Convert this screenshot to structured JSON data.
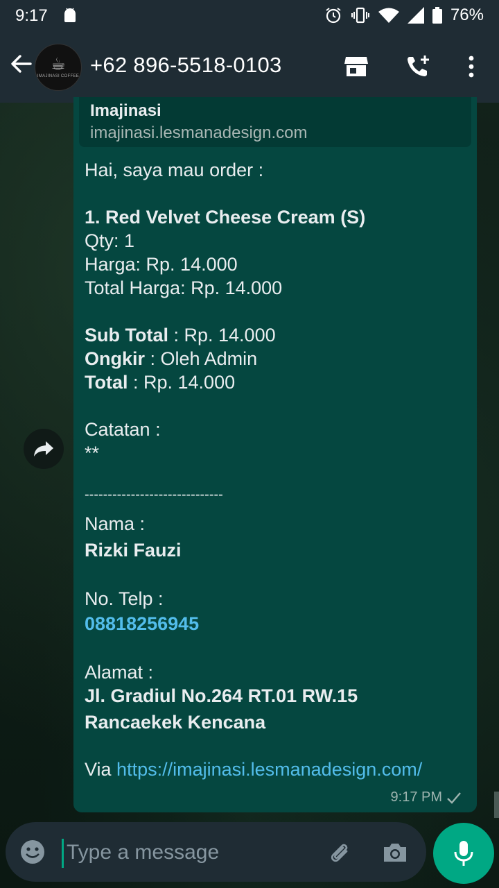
{
  "status_bar": {
    "time": "9:17",
    "battery": "76%"
  },
  "header": {
    "contact": "+62 896-5518-0103",
    "avatar_brand": "IMAJINASI COFFEE"
  },
  "link_preview": {
    "title": "Imajinasi",
    "url": "imajinasi.lesmanadesign.com"
  },
  "message": {
    "greeting": "Hai, saya mau order :",
    "item_name": "1. Red Velvet Cheese Cream (S)",
    "qty": "Qty: 1",
    "price": "Harga: Rp. 14.000",
    "item_total": "Total Harga: Rp. 14.000",
    "subtotal_label": "Sub Total",
    "subtotal_value": " : Rp. 14.000",
    "ongkir_label": "Ongkir",
    "ongkir_value": " : Oleh Admin",
    "total_label": "Total",
    "total_value": " : Rp. 14.000",
    "notes_label": "Catatan :",
    "notes_value": "**",
    "divider": "------------------------------",
    "name_label": "Nama :",
    "name_value": "Rizki Fauzi",
    "phone_label": "No. Telp :",
    "phone_value": "08818256945",
    "address_label": "Alamat :",
    "address_line1": "Jl. Gradiul No.264 RT.01 RW.15",
    "address_line2": "Rancaekek Kencana",
    "via_label": "Via ",
    "via_link": "https://imajinasi.lesmanadesign.com/",
    "timestamp": "9:17 PM"
  },
  "input": {
    "placeholder": "Type a message"
  },
  "colors": {
    "accent": "#00a884",
    "bubble": "#054740",
    "bar": "#1f2c34",
    "link": "#53bdeb"
  }
}
